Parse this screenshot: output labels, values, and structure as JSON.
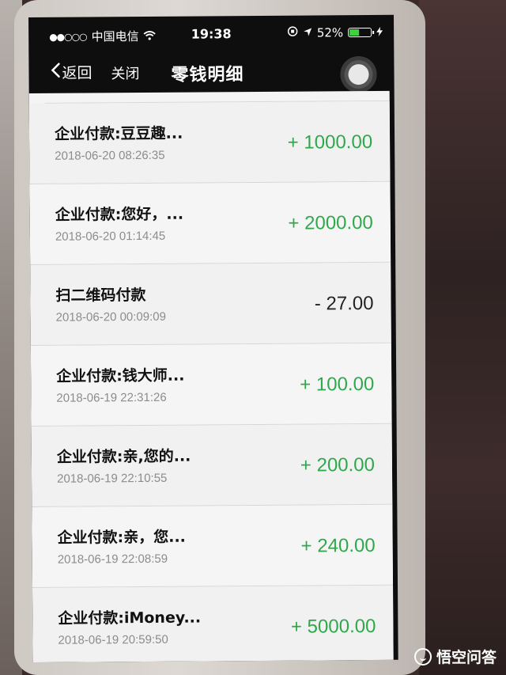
{
  "status_bar": {
    "carrier": "中国电信",
    "signal_dots": "●●○○○",
    "wifi_icon": "wifi-icon",
    "time": "19:38",
    "battery_percent": "52%",
    "battery_level": 0.52,
    "battery_color": "#3cd33c"
  },
  "nav": {
    "back_label": "返回",
    "close_label": "关闭",
    "title": "零钱明细"
  },
  "transactions": [
    {
      "title": "企业付款:豆豆趣...",
      "time": "2018-06-20 08:26:35",
      "amount": "+ 1000.00",
      "direction": "income"
    },
    {
      "title": "企业付款:您好，...",
      "time": "2018-06-20 01:14:45",
      "amount": "+ 2000.00",
      "direction": "income"
    },
    {
      "title": "扫二维码付款",
      "time": "2018-06-20 00:09:09",
      "amount": "- 27.00",
      "direction": "expense"
    },
    {
      "title": "企业付款:钱大师...",
      "time": "2018-06-19 22:31:26",
      "amount": "+ 100.00",
      "direction": "income"
    },
    {
      "title": "企业付款:亲,您的...",
      "time": "2018-06-19 22:10:55",
      "amount": "+ 200.00",
      "direction": "income"
    },
    {
      "title": "企业付款:亲，您...",
      "time": "2018-06-19 22:08:59",
      "amount": "+ 240.00",
      "direction": "income"
    },
    {
      "title": "企业付款:iMoney...",
      "time": "2018-06-19 20:59:50",
      "amount": "+ 5000.00",
      "direction": "income"
    }
  ],
  "colors": {
    "income": "#2ea84a",
    "expense": "#222222"
  },
  "watermark": {
    "text": "悟空问答"
  }
}
